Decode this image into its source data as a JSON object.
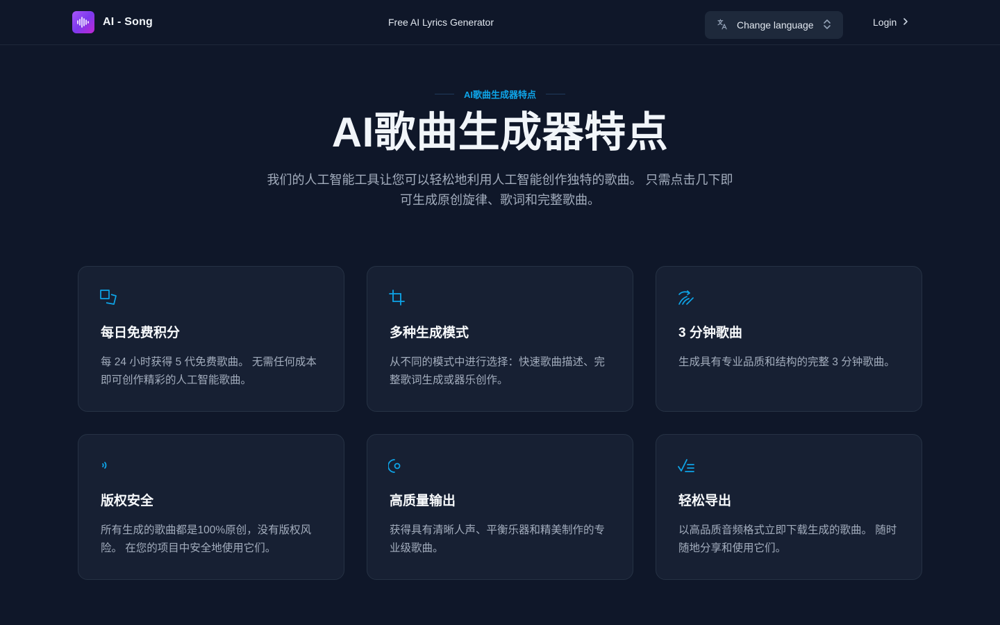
{
  "header": {
    "brand": "AI - Song",
    "nav_center": "Free AI Lyrics Generator",
    "language_button": "Change language",
    "login": "Login"
  },
  "hero": {
    "eyebrow": "AI歌曲生成器特点",
    "title": "AI歌曲生成器特点",
    "description": "我们的人工智能工具让您可以轻松地利用人工智能创作独特的歌曲。 只需点击几下即可生成原创旋律、歌词和完整歌曲。"
  },
  "features": [
    {
      "icon": "squares-icon",
      "title": "每日免费积分",
      "desc": "每 24 小时获得 5 代免费歌曲。 无需任何成本即可创作精彩的人工智能歌曲。"
    },
    {
      "icon": "crop-icon",
      "title": "多种生成模式",
      "desc": "从不同的模式中进行选择：快速歌曲描述、完整歌词生成或器乐创作。"
    },
    {
      "icon": "ear-icon",
      "title": "3 分钟歌曲",
      "desc": "生成具有专业品质和结构的完整 3 分钟歌曲。"
    },
    {
      "icon": "sound-wave-icon",
      "title": "版权安全",
      "desc": "所有生成的歌曲都是100%原创，没有版权风险。 在您的项目中安全地使用它们。"
    },
    {
      "icon": "radio-icon",
      "title": "高质量输出",
      "desc": "获得具有清晰人声、平衡乐器和精美制作的专业级歌曲。"
    },
    {
      "icon": "check-list-icon",
      "title": "轻松导出",
      "desc": "以高品质音频格式立即下载生成的歌曲。 随时随地分享和使用它们。"
    }
  ],
  "colors": {
    "accent": "#0ea5e9",
    "background": "#0f1729",
    "card": "#172033"
  }
}
